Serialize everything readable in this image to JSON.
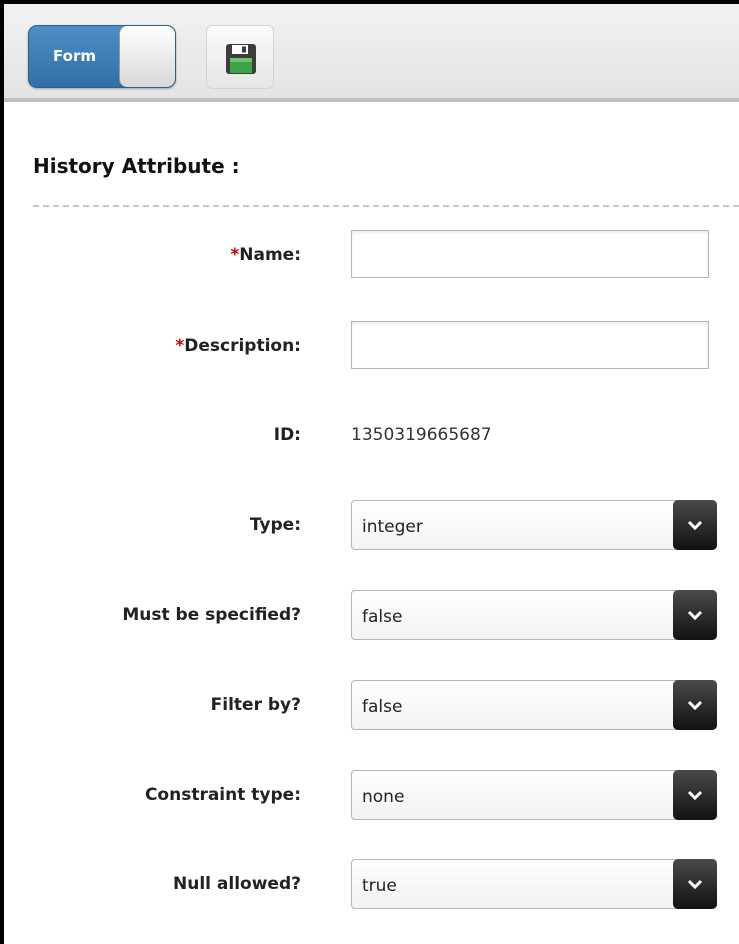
{
  "toolbar": {
    "toggle_label": "Form",
    "save_icon": "floppy-disk-icon"
  },
  "section": {
    "title": "History Attribute :"
  },
  "form": {
    "required_marker": "*",
    "name": {
      "label": "Name:",
      "value": ""
    },
    "description": {
      "label": "Description:",
      "value": ""
    },
    "id": {
      "label": "ID:",
      "value": "1350319665687"
    },
    "type": {
      "label": "Type:",
      "value": "integer"
    },
    "must_be_specified": {
      "label": "Must be specified?",
      "value": "false"
    },
    "filter_by": {
      "label": "Filter by?",
      "value": "false"
    },
    "constraint_type": {
      "label": "Constraint type:",
      "value": "none"
    },
    "null_allowed": {
      "label": "Null allowed?",
      "value": "true"
    }
  },
  "colors": {
    "toggle_blue": "#3a7ab5",
    "required_red": "#d10000",
    "dropdown_arrow_bg": "#1a1a1a"
  }
}
